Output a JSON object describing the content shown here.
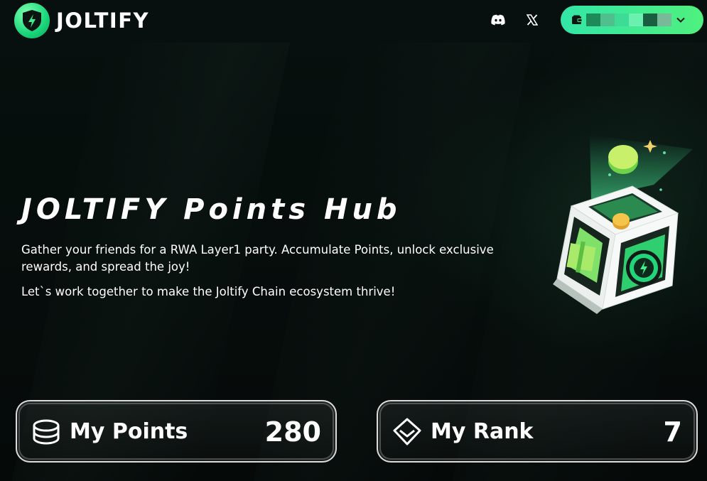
{
  "header": {
    "logo_text": "JOLTIFY",
    "logo_icon": "shield-bolt-icon",
    "social": [
      {
        "name": "discord-icon"
      },
      {
        "name": "x-twitter-icon"
      }
    ],
    "wallet": {
      "icon": "wallet-icon",
      "dropdown_icon": "chevron-down-icon",
      "address_redacted": true
    }
  },
  "hero": {
    "title": "JOLTIFY Points Hub",
    "description": "Gather your friends for a RWA Layer1 party. Accumulate Points, unlock exclusive rewards, and spread the joy!",
    "description2": "Let`s work together to make the Joltify Chain ecosystem thrive!",
    "illustration": "points-cube-illustration"
  },
  "stats": {
    "points": {
      "label": "My Points",
      "value": "280",
      "icon": "coins-stack-icon"
    },
    "rank": {
      "label": "My Rank",
      "value": "7",
      "icon": "diamond-icon"
    }
  },
  "colors": {
    "accent_green": "#33e6a7",
    "accent_lime": "#4ff07e",
    "background": "#060b0a"
  }
}
